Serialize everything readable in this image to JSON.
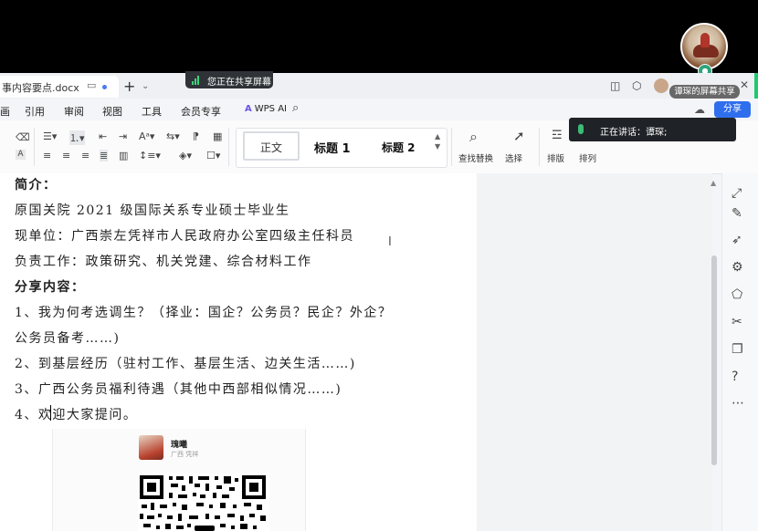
{
  "document": {
    "filename": "事内容要点.docx",
    "lines": [
      {
        "text": "简介：",
        "bold": true
      },
      {
        "text": "原国关院 2021 级国际关系专业硕士毕业生",
        "bold": false
      },
      {
        "text": "现单位：广西崇左凭祥市人民政府办公室四级主任科员",
        "bold": false
      },
      {
        "text": "负责工作：政策研究、机关党建、综合材料工作",
        "bold": false
      },
      {
        "text": "分享内容：",
        "bold": true
      },
      {
        "text": "1、我为何考选调生？（择业：国企？公务员？民企？外企？",
        "bold": false
      },
      {
        "text": "公务员备考……)",
        "bold": false
      },
      {
        "text": "2、到基层经历（驻村工作、基层生活、边关生活……)",
        "bold": false
      },
      {
        "text": "3、广西公务员福利待遇（其他中西部相似情况……)",
        "bold": false
      },
      {
        "text": "4、欢迎大家提问。",
        "bold": false
      }
    ]
  },
  "overlay": {
    "sharing_pill": "您正在共享屏幕",
    "sharing_tip": "谭琛的屏幕共享",
    "speaking": "正在讲话：谭琛;"
  },
  "menu": [
    "画",
    "引用",
    "审阅",
    "视图",
    "工具",
    "会员专享"
  ],
  "wps_ai": "WPS AI",
  "share_button": "分享",
  "styles": {
    "normal": "正文",
    "h1": "标题 1",
    "h2": "标题 2"
  },
  "tools": {
    "find_replace": "查找替换",
    "select": "选择",
    "layout": "排版",
    "arrange": "排列"
  },
  "card": {
    "name": "瑰曦",
    "sub": "广西 凭祥"
  },
  "colors": {
    "accent": "#2f6fee",
    "share_green": "#20c870",
    "page_bg": "#ffffff"
  }
}
